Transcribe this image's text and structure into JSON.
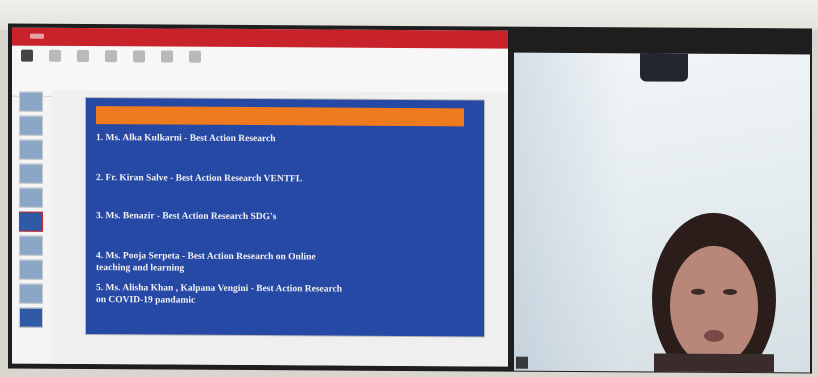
{
  "powerpoint": {
    "window_title": "",
    "slide": {
      "header": "",
      "awards": [
        "1. Ms. Alka Kulkarni - Best Action Research",
        "2. Fr. Kiran Salve - Best Action Research VENTFL",
        "3. Ms. Benazir - Best Action Research SDG's",
        "4. Ms. Pooja Serpeta - Best Action Research on Online",
        "teaching and learning",
        "5. Ms. Alisha Khan , Kalpana Vengini - Best Action Research",
        "on COVID-19 pandamic"
      ]
    }
  },
  "video": {
    "participant_name": ""
  },
  "colors": {
    "ppt_red": "#c8222a",
    "slide_blue": "#2649a6",
    "slide_header_orange": "#f07a1e"
  }
}
